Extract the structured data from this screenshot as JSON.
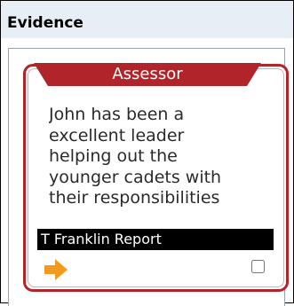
{
  "panel": {
    "title": "Evidence"
  },
  "card": {
    "role": "Assessor",
    "text": "John has been a excellent leader helping out the younger cadets with their responsibilities",
    "report_label": "T Franklin Report",
    "selected": false
  },
  "icons": {
    "view": "arrow-right-icon",
    "select": "checkbox-icon"
  },
  "colors": {
    "accent": "#b0242a",
    "arrow": "#f39a1e",
    "header_bg": "#e7eef6"
  }
}
